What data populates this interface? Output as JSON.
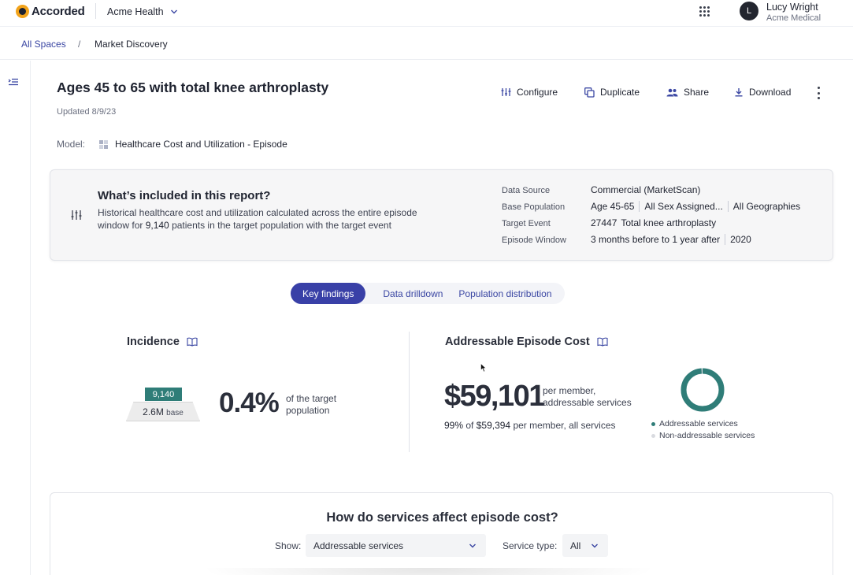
{
  "app": {
    "brand": "Accorded",
    "org_name": "Acme Health",
    "user_initial": "L",
    "user_name": "Lucy Wright",
    "user_org": "Acme Medical"
  },
  "breadcrumb": {
    "root": "All Spaces",
    "separator": "/",
    "current": "Market Discovery"
  },
  "report": {
    "title": "Ages 45 to 65 with total knee arthroplasty",
    "updated": "Updated 8/9/23",
    "model_label": "Model:",
    "model_name": "Healthcare Cost and Utilization - Episode",
    "actions": {
      "configure": "Configure",
      "duplicate": "Duplicate",
      "share": "Share",
      "download": "Download"
    }
  },
  "included": {
    "title": "What’s included in this report?",
    "desc_pre": "Historical healthcare cost and utilization calculated across the entire episode window for ",
    "desc_count": "9,140",
    "desc_post": " patients in the target population with the target event",
    "data_source_label": "Data Source",
    "data_source": "Commercial (MarketScan)",
    "base_population_label": "Base Population",
    "base_population": [
      "Age 45-65",
      "All Sex Assigned...",
      "All Geographies"
    ],
    "target_event_label": "Target Event",
    "target_event_code": "27447",
    "target_event_name": "Total knee arthroplasty",
    "episode_window_label": "Episode Window",
    "episode_window": "3 months before to 1 year after",
    "episode_year": "2020"
  },
  "tabs": [
    "Key findings",
    "Data drilldown",
    "Population distribution"
  ],
  "incidence": {
    "title": "Incidence",
    "count": "9,140",
    "base_value": "2.6M",
    "base_word": "base",
    "percent": "0.4%",
    "percent_desc": "of the target population"
  },
  "episode_cost": {
    "title": "Addressable Episode Cost",
    "value": "$59,101",
    "value_desc": "per member, addressable services",
    "sub_pct": "99%",
    "sub_of": " of ",
    "sub_total": "$59,394",
    "sub_post": " per member, all services",
    "addressable_share": 0.99,
    "legend_addressable": "Addressable services",
    "legend_non": "Non-addressable services",
    "color_addressable": "#2f7d78",
    "color_non": "#d9dbe0"
  },
  "services": {
    "title": "How do services affect episode cost?",
    "show_label": "Show:",
    "show_value": "Addressable services",
    "type_label": "Service type:",
    "type_value": "All"
  }
}
